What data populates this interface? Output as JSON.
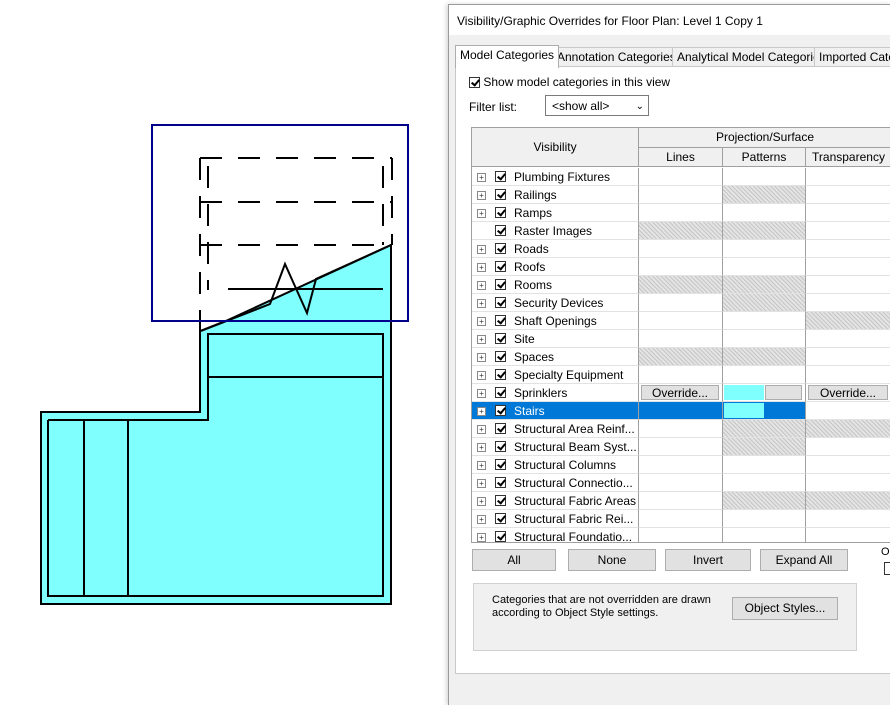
{
  "dialog": {
    "title": "Visibility/Graphic Overrides for Floor Plan: Level 1 Copy 1",
    "tabs": [
      "Model Categories",
      "Annotation Categories",
      "Analytical Model Categories",
      "Imported Cate"
    ],
    "show_checkbox_label": "Show model categories in this view",
    "filter_label": "Filter list:",
    "filter_value": "<show all>",
    "columns": {
      "visibility": "Visibility",
      "group": "Projection/Surface",
      "lines": "Lines",
      "patterns": "Patterns",
      "transparency": "Transparency"
    },
    "rows": [
      {
        "label": "Plumbing Fixtures",
        "checked": true
      },
      {
        "label": "Railings",
        "checked": true
      },
      {
        "label": "Ramps",
        "checked": true
      },
      {
        "label": "Raster Images",
        "checked": true
      },
      {
        "label": "Roads",
        "checked": true
      },
      {
        "label": "Roofs",
        "checked": true
      },
      {
        "label": "Rooms",
        "checked": true
      },
      {
        "label": "Security Devices",
        "checked": true
      },
      {
        "label": "Shaft Openings",
        "checked": true
      },
      {
        "label": "Site",
        "checked": true
      },
      {
        "label": "Spaces",
        "checked": true
      },
      {
        "label": "Specialty Equipment",
        "checked": true
      },
      {
        "label": "Sprinklers",
        "checked": true
      },
      {
        "label": "Stairs",
        "checked": true
      },
      {
        "label": "Structural Area Reinf...",
        "checked": true
      },
      {
        "label": "Structural Beam Syst...",
        "checked": true
      },
      {
        "label": "Structural Columns",
        "checked": true
      },
      {
        "label": "Structural Connectio...",
        "checked": true
      },
      {
        "label": "Structural Fabric Areas",
        "checked": true
      },
      {
        "label": "Structural Fabric Rei...",
        "checked": true
      },
      {
        "label": "Structural Foundatio...",
        "checked": true
      }
    ],
    "override_label": "Override...",
    "buttons": {
      "all": "All",
      "none": "None",
      "invert": "Invert",
      "expand_all": "Expand All"
    },
    "note": "Categories that are not overridden are drawn according to Object Style settings.",
    "object_styles": "Object Styles...",
    "cut_off_label": "O"
  },
  "colors": {
    "stair_fill": "#80ffff",
    "selection": "#0078d7",
    "crop_region": "#00008b"
  }
}
